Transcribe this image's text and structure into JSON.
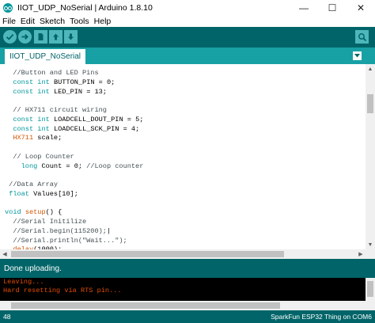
{
  "window": {
    "title": "IIOT_UDP_NoSerial | Arduino 1.8.10",
    "minimize": "—",
    "maximize": "☐",
    "close": "✕"
  },
  "menu": [
    "File",
    "Edit",
    "Sketch",
    "Tools",
    "Help"
  ],
  "toolbar": {
    "buttons": [
      "verify-icon",
      "upload-icon",
      "new-icon",
      "open-icon",
      "save-icon",
      "serial-monitor-icon"
    ]
  },
  "tabs": [
    {
      "label": "IIOT_UDP_NoSerial"
    }
  ],
  "code": [
    [
      {
        "t": "  //Button and LED Pins",
        "c": "cm"
      }
    ],
    [
      {
        "t": "  ",
        "c": "tx"
      },
      {
        "t": "const",
        "c": "kw"
      },
      {
        "t": " ",
        "c": "tx"
      },
      {
        "t": "int",
        "c": "kw"
      },
      {
        "t": " BUTTON_PIN = 0;",
        "c": "tx"
      }
    ],
    [
      {
        "t": "  ",
        "c": "tx"
      },
      {
        "t": "const",
        "c": "kw"
      },
      {
        "t": " ",
        "c": "tx"
      },
      {
        "t": "int",
        "c": "kw"
      },
      {
        "t": " LED_PIN = 13;",
        "c": "tx"
      }
    ],
    [
      {
        "t": "",
        "c": "tx"
      }
    ],
    [
      {
        "t": "  // HX711 circuit wiring",
        "c": "cm"
      }
    ],
    [
      {
        "t": "  ",
        "c": "tx"
      },
      {
        "t": "const",
        "c": "kw"
      },
      {
        "t": " ",
        "c": "tx"
      },
      {
        "t": "int",
        "c": "kw"
      },
      {
        "t": " LOADCELL_DOUT_PIN = 5;",
        "c": "tx"
      }
    ],
    [
      {
        "t": "  ",
        "c": "tx"
      },
      {
        "t": "const",
        "c": "kw"
      },
      {
        "t": " ",
        "c": "tx"
      },
      {
        "t": "int",
        "c": "kw"
      },
      {
        "t": " LOADCELL_SCK_PIN = 4;",
        "c": "tx"
      }
    ],
    [
      {
        "t": "  ",
        "c": "tx"
      },
      {
        "t": "HX711",
        "c": "fn"
      },
      {
        "t": " scale;",
        "c": "tx"
      }
    ],
    [
      {
        "t": "",
        "c": "tx"
      }
    ],
    [
      {
        "t": "  // Loop Counter",
        "c": "cm"
      }
    ],
    [
      {
        "t": "    ",
        "c": "tx"
      },
      {
        "t": "long",
        "c": "kw"
      },
      {
        "t": " Count = 0; ",
        "c": "tx"
      },
      {
        "t": "//Loop counter",
        "c": "cm"
      }
    ],
    [
      {
        "t": "",
        "c": "tx"
      }
    ],
    [
      {
        "t": " //Data Array",
        "c": "cm"
      }
    ],
    [
      {
        "t": " ",
        "c": "tx"
      },
      {
        "t": "float",
        "c": "kw"
      },
      {
        "t": " Values[10];",
        "c": "tx"
      }
    ],
    [
      {
        "t": "",
        "c": "tx"
      }
    ],
    [
      {
        "t": "void",
        "c": "kw"
      },
      {
        "t": " ",
        "c": "tx"
      },
      {
        "t": "setup",
        "c": "fn"
      },
      {
        "t": "() {",
        "c": "tx"
      }
    ],
    [
      {
        "t": "  //Serial Initilize",
        "c": "cm"
      }
    ],
    [
      {
        "t": "  //Serial.begin(115200);",
        "c": "cm"
      },
      {
        "t": "|",
        "c": "tx"
      }
    ],
    [
      {
        "t": "  //Serial.println(\"Wait...\");",
        "c": "cm"
      }
    ],
    [
      {
        "t": "  ",
        "c": "tx"
      },
      {
        "t": "delay",
        "c": "fn"
      },
      {
        "t": "(1000);",
        "c": "tx"
      }
    ]
  ],
  "status": {
    "message": "Done uploading."
  },
  "console": {
    "lines": [
      "Leaving...",
      "Hard resetting via RTS pin..."
    ]
  },
  "footer": {
    "line_number": "48",
    "board": "SparkFun ESP32 Thing on COM6"
  },
  "colors": {
    "toolbar": "#006468",
    "tabbar": "#17a1a5",
    "keyword": "#00979c",
    "function": "#d35400",
    "console_text": "#e34c00"
  }
}
